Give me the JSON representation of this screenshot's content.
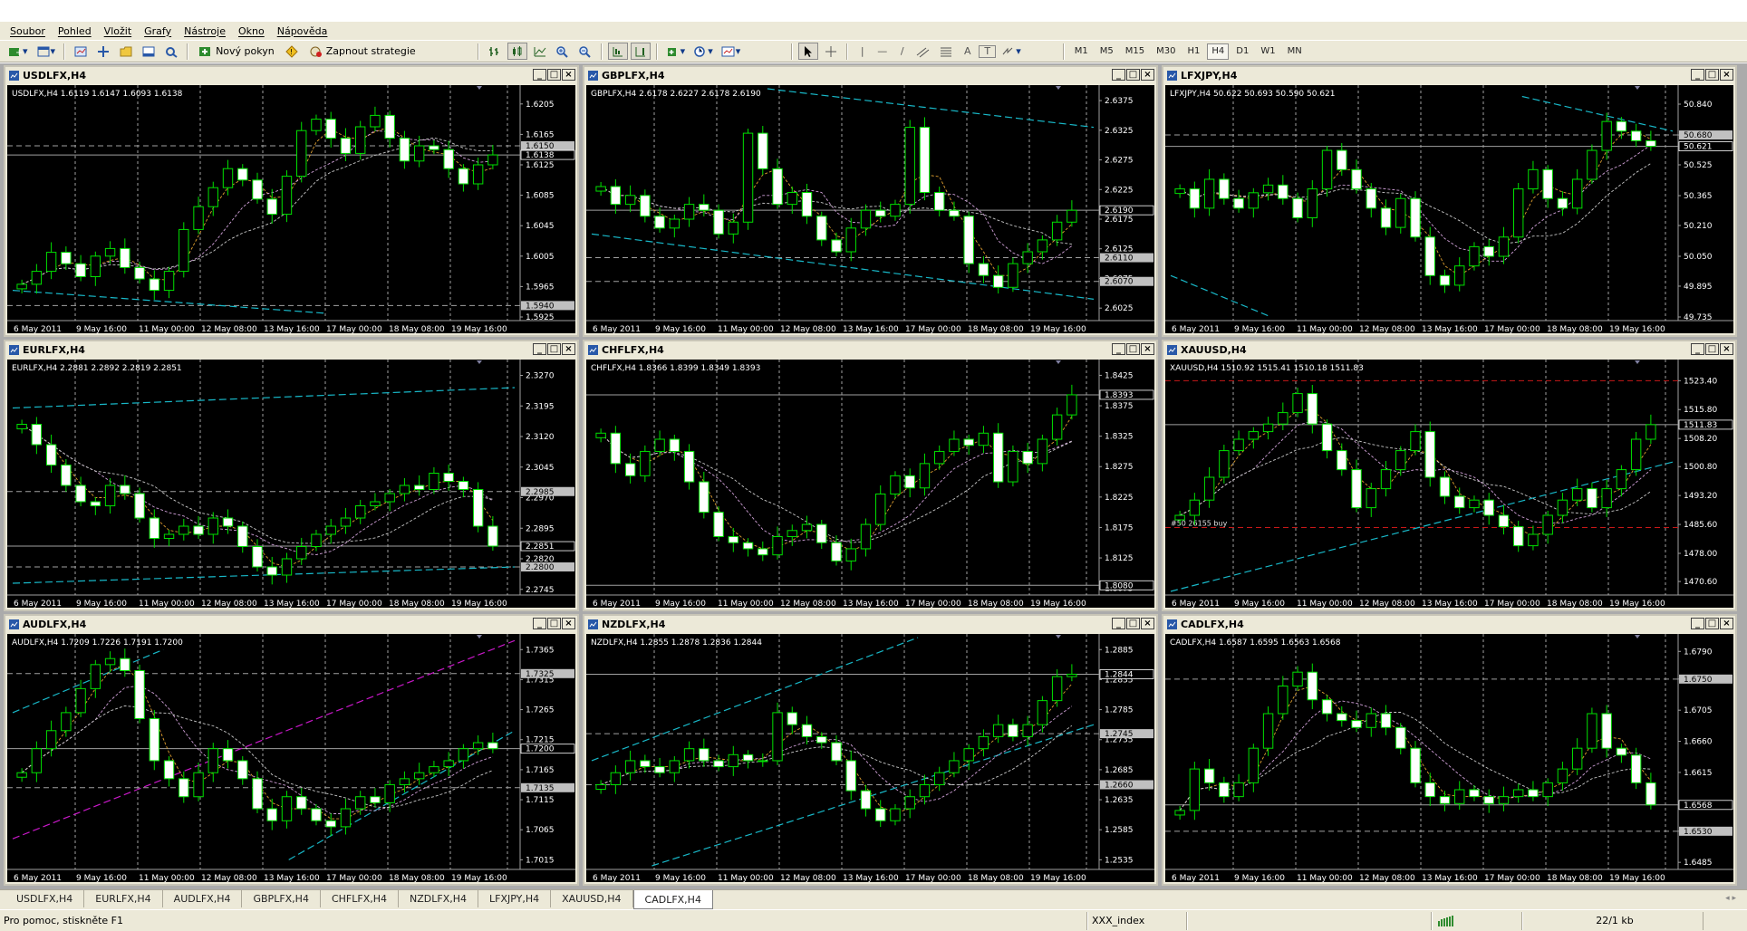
{
  "menu": [
    "Soubor",
    "Pohled",
    "Vložit",
    "Grafy",
    "Nástroje",
    "Okno",
    "Nápověda"
  ],
  "toolbar": {
    "new_order": "Nový pokyn",
    "start_strategy": "Zapnout strategie",
    "timeframes": [
      "M1",
      "M5",
      "M15",
      "M30",
      "H1",
      "H4",
      "D1",
      "W1",
      "MN"
    ],
    "active_timeframe": "H4",
    "draw_tools": [
      "|",
      "—",
      "/",
      "A",
      "T"
    ]
  },
  "x_axis_labels": [
    "6 May 2011",
    "9 May 16:00",
    "11 May 00:00",
    "12 May 08:00",
    "13 May 16:00",
    "17 May 00:00",
    "18 May 08:00",
    "19 May 16:00"
  ],
  "charts": [
    {
      "title": "USDLFX,H4",
      "ohlc": "USDLFX,H4  1.6119 1.6147 1.6093 1.6138",
      "y_ticks": [
        "1.6205",
        "1.6165",
        "1.6125",
        "1.6085",
        "1.6045",
        "1.6005",
        "1.5965",
        "1.5925"
      ],
      "ymin": 1.5925,
      "ymax": 1.6225,
      "price_boxes": [
        {
          "v": 1.615,
          "t": "1.6150",
          "bg": "#c0c0c0"
        },
        {
          "v": 1.6138,
          "t": "1.6138",
          "bg": "#000000"
        },
        {
          "v": 1.594,
          "t": "1.5940",
          "bg": "#c0c0c0"
        }
      ],
      "hlines": [
        {
          "v": 1.615,
          "c": "#a0a0a0",
          "d": true
        },
        {
          "v": 1.6138,
          "c": "#a0a0a0",
          "d": false
        },
        {
          "v": 1.594,
          "c": "#a0a0a0",
          "d": true
        }
      ],
      "close": [
        1.5968,
        1.5985,
        1.601,
        1.5995,
        1.5978,
        1.6005,
        1.6015,
        1.599,
        1.5975,
        1.596,
        1.5985,
        1.604,
        1.607,
        1.6095,
        1.612,
        1.6105,
        1.608,
        1.606,
        1.611,
        1.617,
        1.6185,
        1.616,
        1.614,
        1.6175,
        1.619,
        1.616,
        1.613,
        1.615,
        1.6145,
        1.612,
        1.61,
        1.6125,
        1.6138
      ],
      "lines": [
        {
          "c": "#18b8c8",
          "p": [
            [
              0.0,
              1.596
            ],
            [
              0.62,
              1.593
            ]
          ]
        }
      ]
    },
    {
      "title": "GBPLFX,H4",
      "ohlc": "GBPLFX,H4  2.6178 2.6227 2.6178 2.6190",
      "y_ticks": [
        "2.6375",
        "2.6325",
        "2.6275",
        "2.6225",
        "2.6175",
        "2.6125",
        "2.6075",
        "2.6025"
      ],
      "ymin": 2.601,
      "ymax": 2.6395,
      "price_boxes": [
        {
          "v": 2.619,
          "t": "2.6190",
          "bg": "#000000"
        },
        {
          "v": 2.611,
          "t": "2.6110",
          "bg": "#c0c0c0"
        },
        {
          "v": 2.607,
          "t": "2.6070",
          "bg": "#c0c0c0"
        }
      ],
      "hlines": [
        {
          "v": 2.619,
          "c": "#a0a0a0",
          "d": false
        },
        {
          "v": 2.611,
          "c": "#a0a0a0",
          "d": true
        },
        {
          "v": 2.607,
          "c": "#a0a0a0",
          "d": true
        }
      ],
      "close": [
        2.623,
        2.62,
        2.6215,
        2.618,
        2.616,
        2.6175,
        2.62,
        2.619,
        2.615,
        2.617,
        2.632,
        2.626,
        2.62,
        2.622,
        2.618,
        2.614,
        2.612,
        2.616,
        2.619,
        2.618,
        2.62,
        2.633,
        2.622,
        2.619,
        2.618,
        2.61,
        2.608,
        2.606,
        2.61,
        2.612,
        2.614,
        2.617,
        2.619
      ],
      "lines": [
        {
          "c": "#18b8c8",
          "p": [
            [
              0.35,
              2.6395
            ],
            [
              1.0,
              2.633
            ]
          ]
        },
        {
          "c": "#18b8c8",
          "p": [
            [
              0.0,
              2.615
            ],
            [
              1.0,
              2.604
            ]
          ]
        }
      ]
    },
    {
      "title": "LFXJPY,H4",
      "ohlc": "LFXJPY,H4  50.622 50.693 50.590 50.621",
      "y_ticks": [
        "50.840",
        "50.680",
        "50.525",
        "50.365",
        "50.210",
        "50.050",
        "49.895",
        "49.735"
      ],
      "ymin": 49.735,
      "ymax": 50.92,
      "price_boxes": [
        {
          "v": 50.68,
          "t": "50.680",
          "bg": "#c0c0c0"
        },
        {
          "v": 50.621,
          "t": "50.621",
          "bg": "#000000"
        }
      ],
      "hlines": [
        {
          "v": 50.68,
          "c": "#a0a0a0",
          "d": true
        },
        {
          "v": 50.621,
          "c": "#a0a0a0",
          "d": false
        }
      ],
      "close": [
        50.4,
        50.3,
        50.45,
        50.35,
        50.3,
        50.38,
        50.42,
        50.35,
        50.25,
        50.4,
        50.6,
        50.5,
        50.4,
        50.3,
        50.2,
        50.35,
        50.15,
        49.95,
        49.9,
        50.0,
        50.1,
        50.05,
        50.15,
        50.4,
        50.5,
        50.35,
        50.3,
        50.45,
        50.6,
        50.75,
        50.7,
        50.65,
        50.621
      ],
      "lines": [
        {
          "c": "#18b8c8",
          "p": [
            [
              0.0,
              49.95
            ],
            [
              0.2,
              49.735
            ]
          ]
        },
        {
          "c": "#18b8c8",
          "p": [
            [
              0.7,
              50.88
            ],
            [
              1.0,
              50.7
            ]
          ]
        }
      ]
    },
    {
      "title": "EURLFX,H4",
      "ohlc": "EURLFX,H4  2.2881 2.2892 2.2819 2.2851",
      "y_ticks": [
        "2.3270",
        "2.3195",
        "2.3120",
        "2.3045",
        "2.2970",
        "2.2895",
        "2.2820",
        "2.2745"
      ],
      "ymin": 2.274,
      "ymax": 2.33,
      "price_boxes": [
        {
          "v": 2.2985,
          "t": "2.2985",
          "bg": "#c0c0c0"
        },
        {
          "v": 2.2851,
          "t": "2.2851",
          "bg": "#000000"
        },
        {
          "v": 2.28,
          "t": "2.2800",
          "bg": "#c0c0c0"
        }
      ],
      "hlines": [
        {
          "v": 2.2985,
          "c": "#a0a0a0",
          "d": true
        },
        {
          "v": 2.2851,
          "c": "#a0a0a0",
          "d": false
        },
        {
          "v": 2.28,
          "c": "#a0a0a0",
          "d": true
        }
      ],
      "close": [
        2.315,
        2.31,
        2.305,
        2.3,
        2.296,
        2.295,
        2.3,
        2.298,
        2.292,
        2.287,
        2.288,
        2.29,
        2.288,
        2.292,
        2.29,
        2.285,
        2.28,
        2.278,
        2.282,
        2.285,
        2.288,
        2.29,
        2.292,
        2.295,
        2.296,
        2.298,
        2.3,
        2.299,
        2.303,
        2.301,
        2.299,
        2.29,
        2.2851
      ],
      "lines": [
        {
          "c": "#18b8c8",
          "p": [
            [
              0.0,
              2.319
            ],
            [
              1.0,
              2.324
            ]
          ]
        },
        {
          "c": "#18b8c8",
          "p": [
            [
              0.0,
              2.276
            ],
            [
              1.0,
              2.28
            ]
          ]
        }
      ]
    },
    {
      "title": "CHFLFX,H4",
      "ohlc": "CHFLFX,H4  1.8366 1.8399 1.8349 1.8393",
      "y_ticks": [
        "1.8425",
        "1.8375",
        "1.8325",
        "1.8275",
        "1.8225",
        "1.8175",
        "1.8125",
        "1.8075"
      ],
      "ymin": 1.807,
      "ymax": 1.8445,
      "price_boxes": [
        {
          "v": 1.8393,
          "t": "1.8393",
          "bg": "#000000"
        },
        {
          "v": 1.808,
          "t": "1.8080",
          "bg": "#000000"
        }
      ],
      "hlines": [
        {
          "v": 1.8393,
          "c": "#a0a0a0",
          "d": false
        },
        {
          "v": 1.808,
          "c": "#a0a0a0",
          "d": false
        }
      ],
      "close": [
        1.833,
        1.828,
        1.826,
        1.83,
        1.832,
        1.83,
        1.825,
        1.82,
        1.816,
        1.815,
        1.814,
        1.813,
        1.816,
        1.817,
        1.818,
        1.815,
        1.812,
        1.814,
        1.818,
        1.823,
        1.826,
        1.824,
        1.828,
        1.83,
        1.832,
        1.831,
        1.833,
        1.825,
        1.83,
        1.828,
        1.832,
        1.836,
        1.8393
      ],
      "lines": []
    },
    {
      "title": "XAUUSD,H4",
      "ohlc": "XAUUSD,H4  1510.92 1515.41 1510.18 1511.83",
      "y_ticks": [
        "1523.40",
        "1515.80",
        "1508.20",
        "1500.80",
        "1493.20",
        "1485.60",
        "1478.00",
        "1470.60"
      ],
      "ymin": 1468.0,
      "ymax": 1528.0,
      "price_boxes": [
        {
          "v": 1511.83,
          "t": "1511.83",
          "bg": "#000000"
        }
      ],
      "hlines": [
        {
          "v": 1511.83,
          "c": "#a0a0a0",
          "d": false
        },
        {
          "v": 1523.4,
          "c": "#c81818",
          "d": true
        },
        {
          "v": 1484.8,
          "c": "#c81818",
          "d": true
        }
      ],
      "hline_label": {
        "v": 1484.8,
        "t": "#50 26155 buy"
      },
      "close": [
        1488.0,
        1492.0,
        1498.0,
        1505.0,
        1508.0,
        1510.0,
        1512.0,
        1515.0,
        1520.0,
        1512.0,
        1505.0,
        1500.0,
        1490.0,
        1495.0,
        1500.0,
        1505.0,
        1510.0,
        1498.0,
        1493.0,
        1490.0,
        1492.0,
        1488.0,
        1485.0,
        1480.0,
        1483.0,
        1488.0,
        1492.0,
        1495.0,
        1490.0,
        1495.0,
        1500.0,
        1508.0,
        1511.83
      ],
      "lines": [
        {
          "c": "#18b8c8",
          "p": [
            [
              0.0,
              1468.0
            ],
            [
              1.0,
              1502.0
            ]
          ]
        }
      ]
    },
    {
      "title": "AUDLFX,H4",
      "ohlc": "AUDLFX,H4  1.7209 1.7226 1.7191 1.7200",
      "y_ticks": [
        "1.7365",
        "1.7315",
        "1.7265",
        "1.7215",
        "1.7165",
        "1.7115",
        "1.7065",
        "1.7015"
      ],
      "ymin": 1.7005,
      "ymax": 1.7385,
      "price_boxes": [
        {
          "v": 1.7325,
          "t": "1.7325",
          "bg": "#c0c0c0"
        },
        {
          "v": 1.72,
          "t": "1.7200",
          "bg": "#000000"
        },
        {
          "v": 1.7135,
          "t": "1.7135",
          "bg": "#c0c0c0"
        }
      ],
      "hlines": [
        {
          "v": 1.7325,
          "c": "#a0a0a0",
          "d": true
        },
        {
          "v": 1.72,
          "c": "#a0a0a0",
          "d": false
        },
        {
          "v": 1.7135,
          "c": "#a0a0a0",
          "d": true
        }
      ],
      "close": [
        1.716,
        1.72,
        1.723,
        1.726,
        1.73,
        1.734,
        1.735,
        1.733,
        1.725,
        1.718,
        1.715,
        1.712,
        1.716,
        1.72,
        1.718,
        1.715,
        1.71,
        1.708,
        1.712,
        1.71,
        1.708,
        1.707,
        1.71,
        1.712,
        1.711,
        1.714,
        1.715,
        1.716,
        1.717,
        1.718,
        1.72,
        1.721,
        1.72
      ],
      "lines": [
        {
          "c": "#18b8c8",
          "p": [
            [
              0.0,
              1.726
            ],
            [
              0.3,
              1.7365
            ]
          ]
        },
        {
          "c": "#c818c8",
          "p": [
            [
              0.0,
              1.705
            ],
            [
              1.0,
              1.738
            ]
          ]
        },
        {
          "c": "#18b8c8",
          "p": [
            [
              0.55,
              1.7015
            ],
            [
              1.0,
              1.723
            ]
          ]
        }
      ]
    },
    {
      "title": "NZDLFX,H4",
      "ohlc": "NZDLFX,H4  1.2855 1.2878 1.2836 1.2844",
      "y_ticks": [
        "1.2885",
        "1.2835",
        "1.2785",
        "1.2735",
        "1.2685",
        "1.2635",
        "1.2585",
        "1.2535"
      ],
      "ymin": 1.2525,
      "ymax": 1.2905,
      "price_boxes": [
        {
          "v": 1.2844,
          "t": "1.2844",
          "bg": "#000000"
        },
        {
          "v": 1.2745,
          "t": "1.2745",
          "bg": "#c0c0c0"
        },
        {
          "v": 1.266,
          "t": "1.2660",
          "bg": "#c0c0c0"
        }
      ],
      "hlines": [
        {
          "v": 1.2844,
          "c": "#a0a0a0",
          "d": false
        },
        {
          "v": 1.2745,
          "c": "#a0a0a0",
          "d": true
        },
        {
          "v": 1.266,
          "c": "#a0a0a0",
          "d": true
        }
      ],
      "close": [
        1.266,
        1.268,
        1.27,
        1.269,
        1.268,
        1.27,
        1.272,
        1.27,
        1.269,
        1.271,
        1.27,
        1.27,
        1.278,
        1.276,
        1.274,
        1.273,
        1.27,
        1.265,
        1.262,
        1.26,
        1.262,
        1.264,
        1.266,
        1.268,
        1.27,
        1.272,
        1.274,
        1.276,
        1.274,
        1.276,
        1.28,
        1.284,
        1.2844
      ],
      "lines": [
        {
          "c": "#18b8c8",
          "p": [
            [
              0.0,
              1.27
            ],
            [
              0.65,
              1.2905
            ]
          ]
        },
        {
          "c": "#18b8c8",
          "p": [
            [
              0.12,
              1.2525
            ],
            [
              1.0,
              1.276
            ]
          ]
        }
      ]
    },
    {
      "title": "CADLFX,H4",
      "ohlc": "CADLFX,H4  1.6587 1.6595 1.6563 1.6568",
      "y_ticks": [
        "1.6790",
        "1.6750",
        "1.6705",
        "1.6660",
        "1.6615",
        "1.6570",
        "1.6530",
        "1.6485"
      ],
      "ymin": 1.648,
      "ymax": 1.681,
      "price_boxes": [
        {
          "v": 1.675,
          "t": "1.6750",
          "bg": "#c0c0c0"
        },
        {
          "v": 1.6568,
          "t": "1.6568",
          "bg": "#000000"
        },
        {
          "v": 1.653,
          "t": "1.6530",
          "bg": "#c0c0c0"
        }
      ],
      "hlines": [
        {
          "v": 1.675,
          "c": "#a0a0a0",
          "d": true
        },
        {
          "v": 1.6568,
          "c": "#a0a0a0",
          "d": false
        },
        {
          "v": 1.653,
          "c": "#a0a0a0",
          "d": true
        }
      ],
      "close": [
        1.656,
        1.662,
        1.66,
        1.658,
        1.66,
        1.665,
        1.67,
        1.674,
        1.676,
        1.672,
        1.67,
        1.669,
        1.668,
        1.67,
        1.668,
        1.665,
        1.66,
        1.658,
        1.657,
        1.659,
        1.658,
        1.657,
        1.658,
        1.659,
        1.658,
        1.66,
        1.662,
        1.665,
        1.67,
        1.665,
        1.664,
        1.66,
        1.6568
      ],
      "lines": []
    }
  ],
  "tabs": [
    "USDLFX,H4",
    "EURLFX,H4",
    "AUDLFX,H4",
    "GBPLFX,H4",
    "CHFLFX,H4",
    "NZDLFX,H4",
    "LFXJPY,H4",
    "XAUUSD,H4",
    "CADLFX,H4"
  ],
  "active_tab": "CADLFX,H4",
  "status": {
    "help": "Pro pomoc, stiskněte F1",
    "profile": "XXX_index",
    "traffic": "22/1 kb"
  }
}
